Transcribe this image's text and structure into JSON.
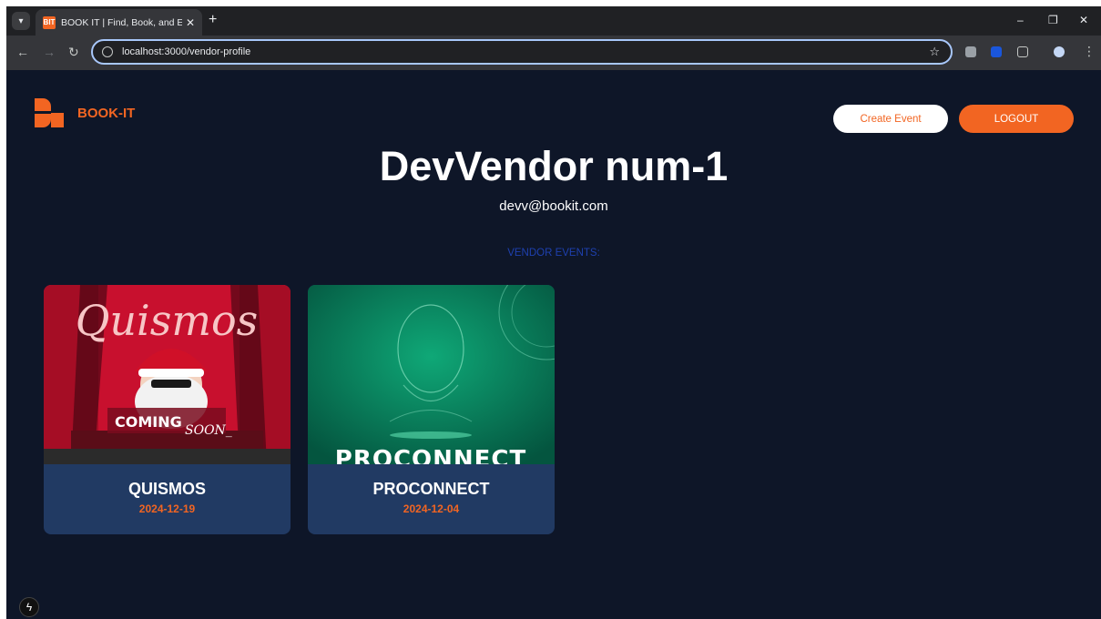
{
  "browser": {
    "tab_title": "BOOK IT | Find, Book, and Enjoy",
    "tab_favicon_text": "BIT",
    "new_tab_symbol": "+",
    "close_symbol": "✕",
    "url": "localhost:3000/vendor-profile",
    "minimize_symbol": "–",
    "restore_symbol": "❐",
    "window_close_symbol": "✕"
  },
  "header": {
    "brand": "BOOK-IT",
    "create_event_label": "Create Event",
    "logout_label": "LOGOUT"
  },
  "profile": {
    "name": "DevVendor num-1",
    "email": "devv@bookit.com",
    "section_label": "VENDOR EVENTS:"
  },
  "events": [
    {
      "title": "QUISMOS",
      "date": "2024-12-19",
      "art_title": "Quismos",
      "art_badge": "COMING",
      "art_badge_script": "SOON_"
    },
    {
      "title": "PROCONNECT",
      "date": "2024-12-04",
      "art_title": "PROCONNECT"
    }
  ],
  "dev_indicator": "ϟ",
  "colors": {
    "accent": "#f26522",
    "background": "#0e1628",
    "card": "#213a63",
    "section_label": "#1e40af"
  }
}
